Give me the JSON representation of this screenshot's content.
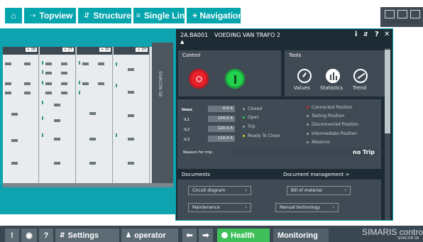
{
  "colors": {
    "teal": "#04a5ad",
    "dark": "#1d2b35",
    "panel": "#3f4a54",
    "open_green": "#23d14e",
    "close_red": "#e8212a"
  },
  "topbar": {
    "home_icon": "home-icon",
    "topview": "Topview",
    "structure": "Structure",
    "single_line": "Single Line",
    "navigation": "+ Navigation",
    "clock": "2:20:16 PM 10/22/"
  },
  "gear": {
    "columns": [
      {
        "label": "+ 28"
      },
      {
        "label": "+ 27"
      },
      {
        "label": "+ 30"
      },
      {
        "label": "+ 2H"
      }
    ],
    "side_label": "SIVACON S8"
  },
  "panel": {
    "id": "2A.BA001",
    "title": "VOEDING VAN TRAFO 2",
    "control": {
      "title": "Control"
    },
    "tools": {
      "title": "Tools",
      "items": [
        "Values",
        "Statistics",
        "Trend"
      ]
    },
    "measurements": [
      {
        "label": "Imax",
        "value": "0.0 A"
      },
      {
        "label": "IL1",
        "value": "100.0 A"
      },
      {
        "label": "IL2",
        "value": "120.0 A"
      },
      {
        "label": "IL3",
        "value": "110.0 A"
      }
    ],
    "states": [
      {
        "label": "Closed",
        "color": "#9aa4ab"
      },
      {
        "label": "Open",
        "color": "#23d14e"
      },
      {
        "label": "Trip",
        "color": "#9aa4ab"
      },
      {
        "label": "Ready To Close",
        "color": "#e3d21d"
      }
    ],
    "positions": [
      {
        "label": "Connected Position",
        "color": "#e8212a"
      },
      {
        "label": "Testing Position",
        "color": "#9aa4ab"
      },
      {
        "label": "Disconnected Position",
        "color": "#9aa4ab"
      },
      {
        "label": "Intermediate Position",
        "color": "#9aa4ab"
      },
      {
        "label": "Absence",
        "color": "#9aa4ab"
      }
    ],
    "reason_label": "Reason for trip:",
    "reason_value": "no Trip",
    "documents_title": "Documents",
    "doc_mgmt": "Document management >",
    "docs": [
      "Circuit diagram",
      "Bill of material",
      "Maintenance",
      "Manual technology"
    ]
  },
  "bottombar": {
    "settings": "Settings",
    "operator": "operator",
    "health": "Health",
    "monitoring": "Monitoring",
    "brand": "SIMARIS contro",
    "brand_sub": "SIVACON S8"
  }
}
